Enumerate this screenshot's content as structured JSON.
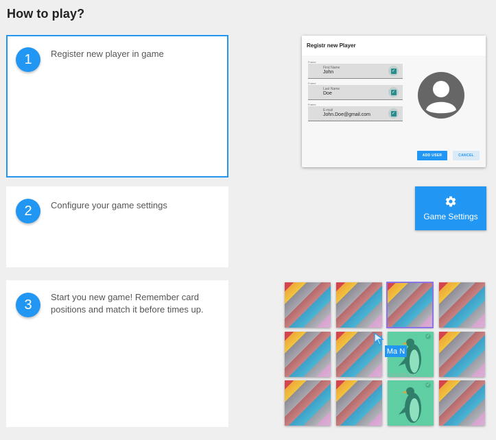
{
  "page": {
    "title": "How to play?"
  },
  "steps": [
    {
      "number": "1",
      "text": "Register new player in game"
    },
    {
      "number": "2",
      "text": "Configure your game settings"
    },
    {
      "number": "3",
      "text": "Start you new game! Remember card positions and match it before times up."
    }
  ],
  "dialog": {
    "title": "Registr new Player",
    "fields": [
      {
        "caption": "Frame",
        "label": "First Name",
        "value": "John"
      },
      {
        "caption": "Frame",
        "label": "Last Name",
        "value": "Doe"
      },
      {
        "caption": "Frame",
        "label": "E-mail",
        "value": "John.Doe@gmail.com"
      }
    ],
    "add_label": "ADD USER",
    "cancel_label": "CANCEL"
  },
  "game_settings": {
    "label": "Game Settings",
    "icon": "gear-icon"
  },
  "game_board": {
    "tooltip": "Ma N",
    "card_caption": "CardSIBame...",
    "colors": {
      "accent": "#2196f3",
      "matched": "#5fcfa3",
      "selected": "#8a74e8"
    }
  }
}
